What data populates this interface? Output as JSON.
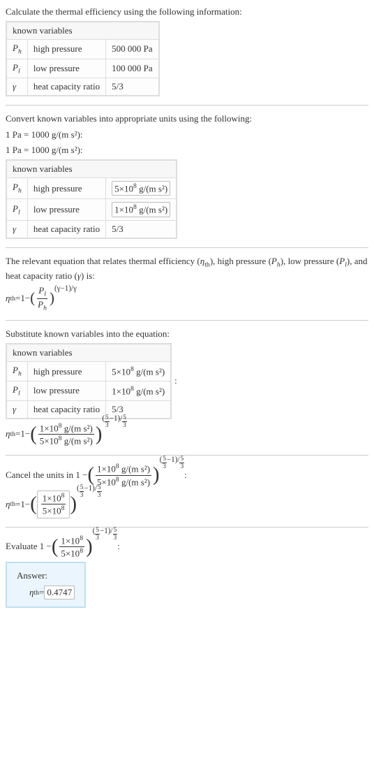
{
  "step1": {
    "intro": "Calculate the thermal efficiency using the following information:",
    "table_header": "known variables",
    "rows": [
      {
        "sym": "P",
        "sub": "h",
        "desc": "high pressure",
        "val": "500 000 Pa"
      },
      {
        "sym": "P",
        "sub": "l",
        "desc": "low pressure",
        "val": "100 000 Pa"
      },
      {
        "sym": "γ",
        "sub": "",
        "desc": "heat capacity ratio",
        "val": "5/3"
      }
    ]
  },
  "step2": {
    "intro": "Convert known variables into appropriate units using the following:",
    "conv1": "1 Pa = 1000 g/(m s²):",
    "conv2": "1 Pa = 1000 g/(m s²):",
    "table_header": "known variables",
    "rows": [
      {
        "sym": "P",
        "sub": "h",
        "desc": "high pressure",
        "val_pre": "5×10",
        "val_exp": "8",
        "val_unit": " g/(m s²)",
        "boxed": true
      },
      {
        "sym": "P",
        "sub": "l",
        "desc": "low pressure",
        "val_pre": "1×10",
        "val_exp": "8",
        "val_unit": " g/(m s²)",
        "boxed": true
      },
      {
        "sym": "γ",
        "sub": "",
        "desc": "heat capacity ratio",
        "val": "5/3",
        "boxed": false
      }
    ]
  },
  "step3": {
    "intro_a": "The relevant equation that relates thermal efficiency (",
    "intro_b": "), high pressure (",
    "intro_c": "), low pressure (",
    "intro_d": "), and heat capacity ratio (",
    "intro_e": ") is:",
    "eta": "η",
    "eta_sub": "th",
    "Ph": "P",
    "Ph_sub": "h",
    "Pl": "P",
    "Pl_sub": "l",
    "gamma": "γ",
    "one": "1",
    "minus": " − ",
    "exp_text": "(γ−1)/γ"
  },
  "step4": {
    "intro": "Substitute known variables into the equation:",
    "table_header": "known variables",
    "rows": [
      {
        "sym": "P",
        "sub": "h",
        "desc": "high pressure",
        "val_pre": "5×10",
        "val_exp": "8",
        "val_unit": " g/(m s²)"
      },
      {
        "sym": "P",
        "sub": "l",
        "desc": "low pressure",
        "val_pre": "1×10",
        "val_exp": "8",
        "val_unit": " g/(m s²)"
      },
      {
        "sym": "γ",
        "sub": "",
        "desc": "heat capacity ratio",
        "val": "5/3"
      }
    ],
    "num_pre": "1×10",
    "num_exp": "8",
    "num_unit": " g/(m s²)",
    "den_pre": "5×10",
    "den_exp": "8",
    "den_unit": " g/(m s²)",
    "exp_num_a": "5",
    "exp_num_b": "3",
    "exp_minus1": "−1",
    "exp_slash": "/",
    "exp_den_a": "5",
    "exp_den_b": "3"
  },
  "step5": {
    "intro_pre": "Cancel the units in 1 − ",
    "num_pre": "1×10",
    "num_exp": "8",
    "num_unit": " g/(m s²)",
    "den_pre": "5×10",
    "den_exp": "8",
    "den_unit": " g/(m s²)",
    "colon": ":",
    "eq_num_pre": "1×10",
    "eq_num_exp": "8",
    "eq_den_pre": "5×10",
    "eq_den_exp": "8"
  },
  "step6": {
    "intro_pre": "Evaluate 1 − ",
    "num_pre": "1×10",
    "num_exp": "8",
    "den_pre": "5×10",
    "den_exp": "8",
    "colon": ":"
  },
  "answer": {
    "label": "Answer:",
    "eta": "η",
    "eta_sub": "th",
    "equals": " = ",
    "val": "0.4747"
  },
  "common": {
    "eta": "η",
    "eta_sub": "th",
    "equals": " = ",
    "one": "1",
    "minus": " − "
  }
}
